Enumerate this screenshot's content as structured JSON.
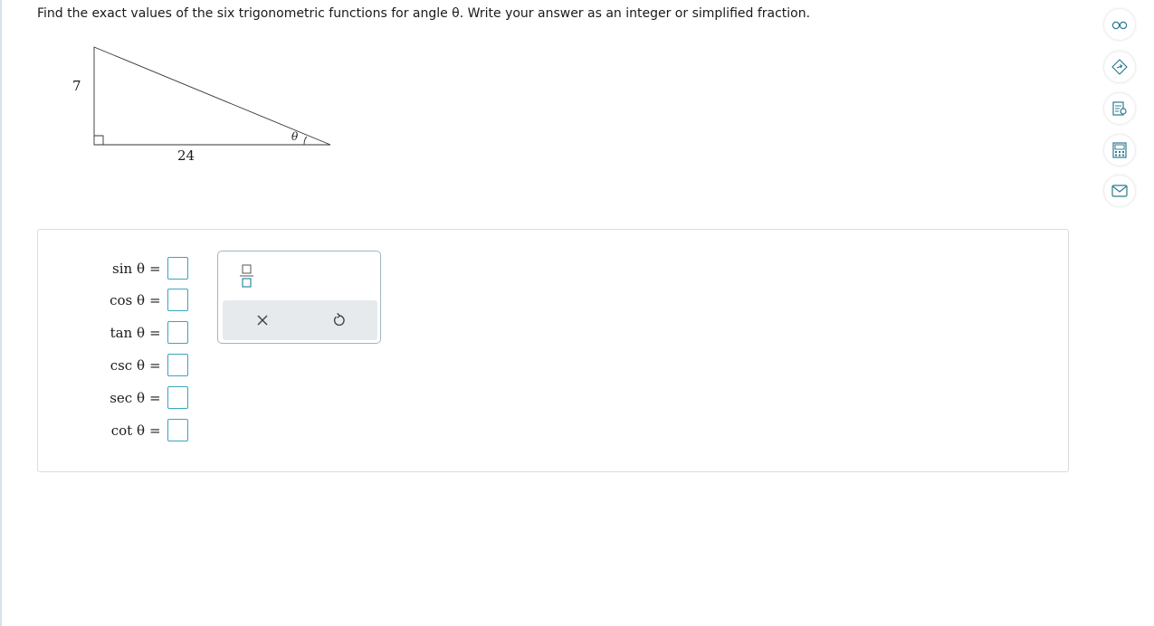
{
  "question": {
    "text": "Find the exact values of the six trigonometric functions for angle θ. Write your answer as an integer or simplified fraction."
  },
  "figure": {
    "side_vertical": "7",
    "side_horizontal": "24",
    "angle_label": "θ"
  },
  "functions": [
    {
      "label": "sin θ",
      "value": ""
    },
    {
      "label": "cos θ",
      "value": ""
    },
    {
      "label": "tan θ",
      "value": ""
    },
    {
      "label": "csc θ",
      "value": ""
    },
    {
      "label": "sec θ",
      "value": ""
    },
    {
      "label": "cot θ",
      "value": ""
    }
  ],
  "equals": "=",
  "keypad": {
    "buttons": [
      "fraction-icon",
      "clear-icon",
      "undo-icon"
    ]
  },
  "side_tools": [
    "glasses-icon",
    "tag-icon",
    "notes-icon",
    "calculator-icon",
    "mail-icon"
  ],
  "colors": {
    "input_border": "#3aa6bf",
    "accent": "#2c8aa6"
  }
}
